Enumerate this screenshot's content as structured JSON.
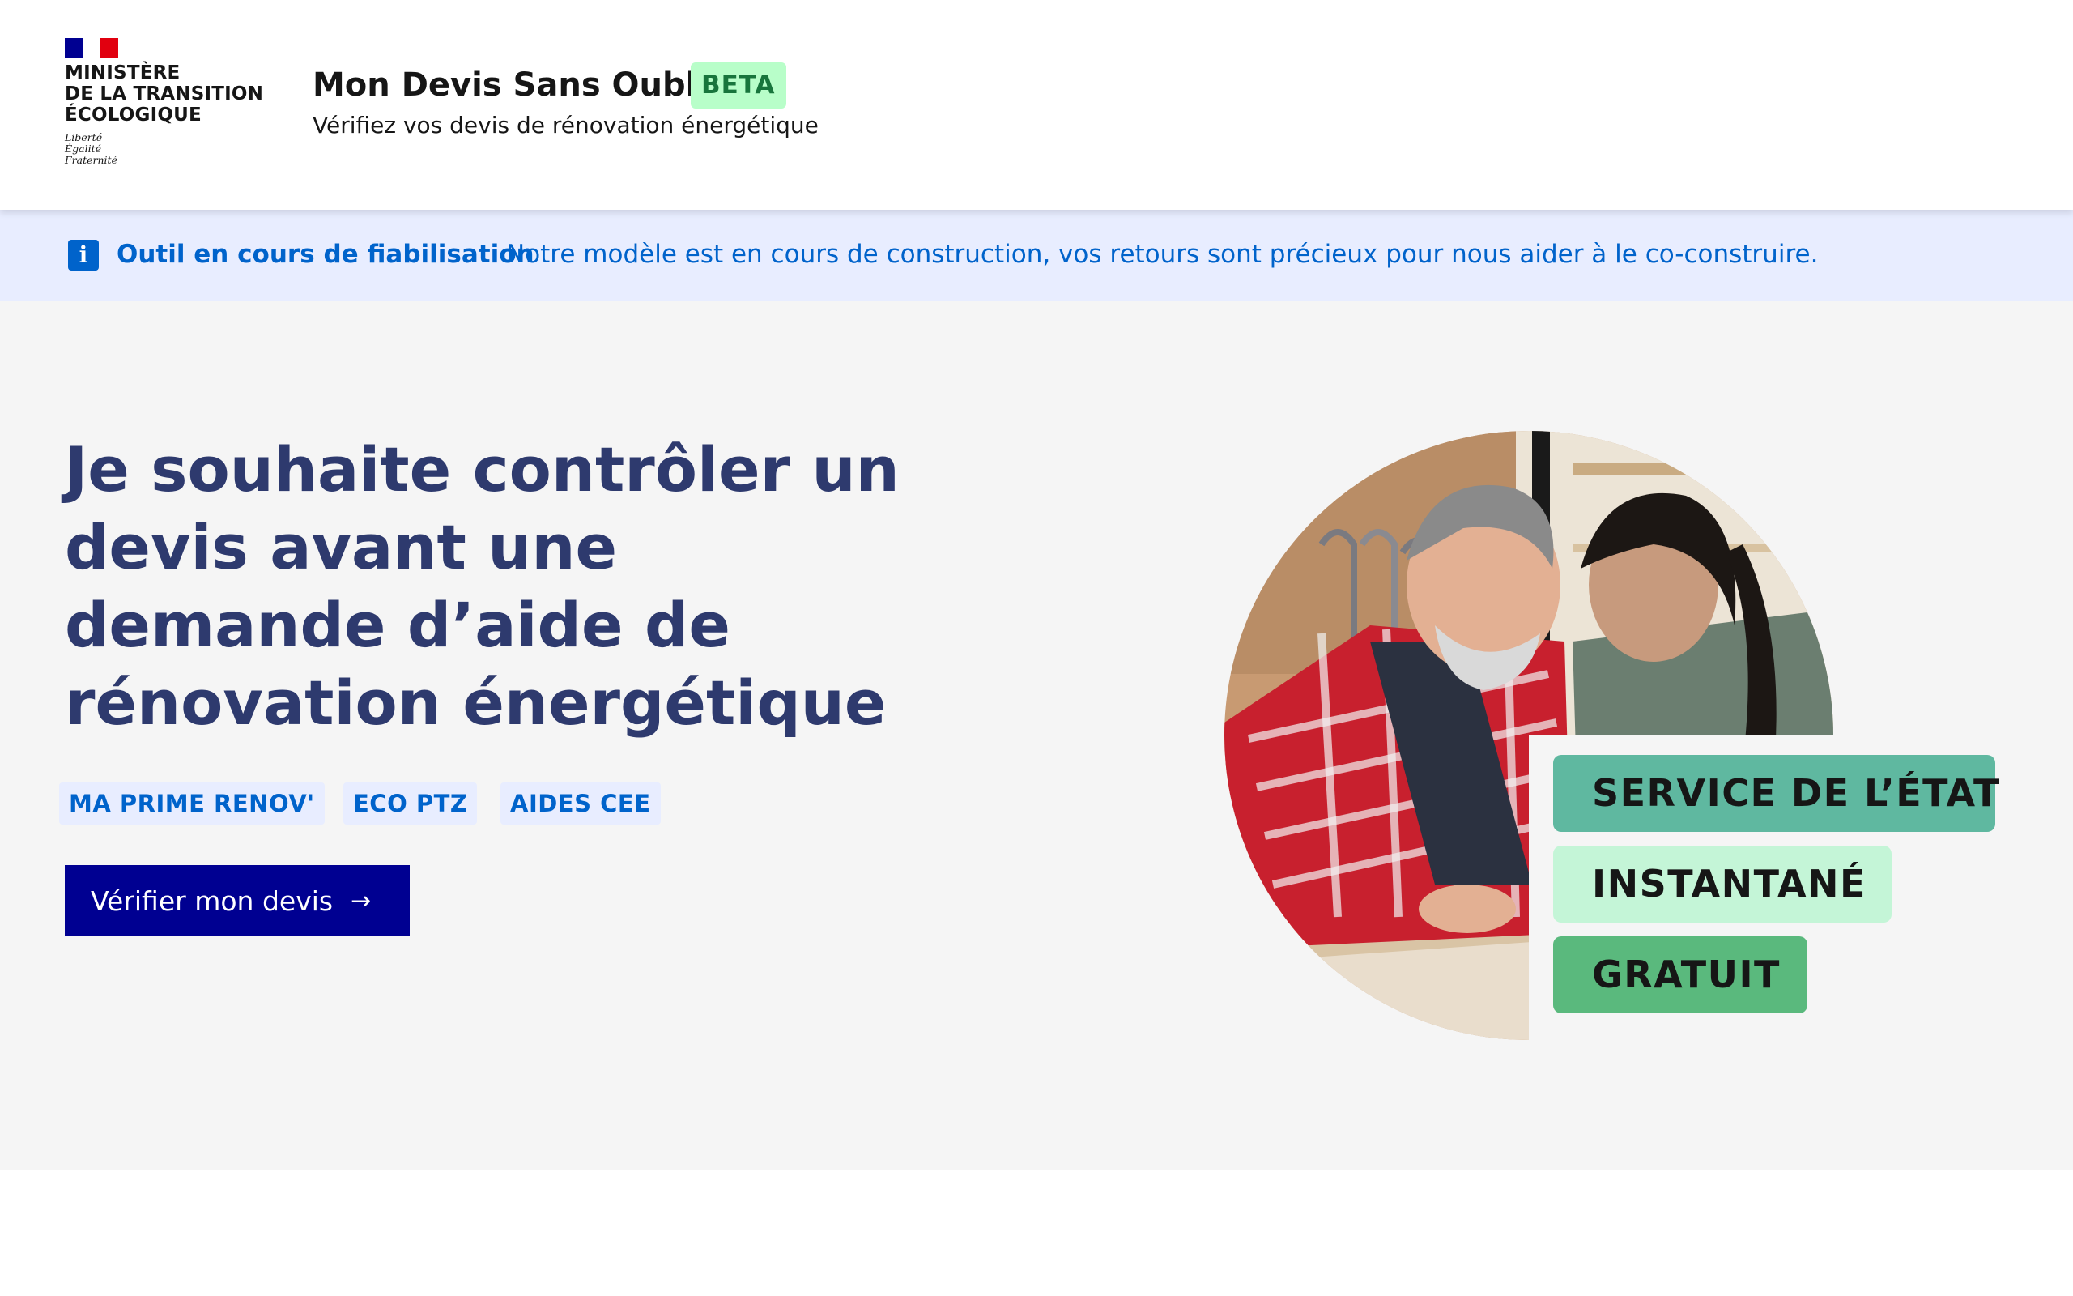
{
  "header": {
    "ministry_name": "MINISTÈRE\nDE LA TRANSITION\nÉCOLOGIQUE",
    "motto": "Liberté\nÉgalité\nFraternité",
    "service_title": "Mon Devis Sans Oublis",
    "beta_badge": "BETA",
    "tagline": "Vérifiez vos devis de rénovation énergétique"
  },
  "notice": {
    "icon": "info-icon",
    "title": "Outil en cours de fiabilisation",
    "text": "Notre modèle est en cours de construction, vos retours sont précieux pour nous aider à le co-construire.",
    "color": "#0063cb"
  },
  "hero": {
    "title": "Je souhaite contrôler un devis avant une demande d’aide de rénovation énergétique",
    "tags": [
      "MA PRIME RENOV'",
      "ECO PTZ",
      "AIDES CEE"
    ],
    "cta_label": "Vérifier mon devis",
    "cta_icon": "arrow-right-icon",
    "pills": [
      "SERVICE DE L’ÉTAT",
      "INSTANTANÉ",
      "GRATUIT"
    ]
  },
  "colors": {
    "brand_blue": "#000091",
    "title_blue": "#2e3a6e",
    "beta_bg": "#b8fec9",
    "beta_text": "#18753c",
    "hero_bg": "#f5f5f5"
  }
}
